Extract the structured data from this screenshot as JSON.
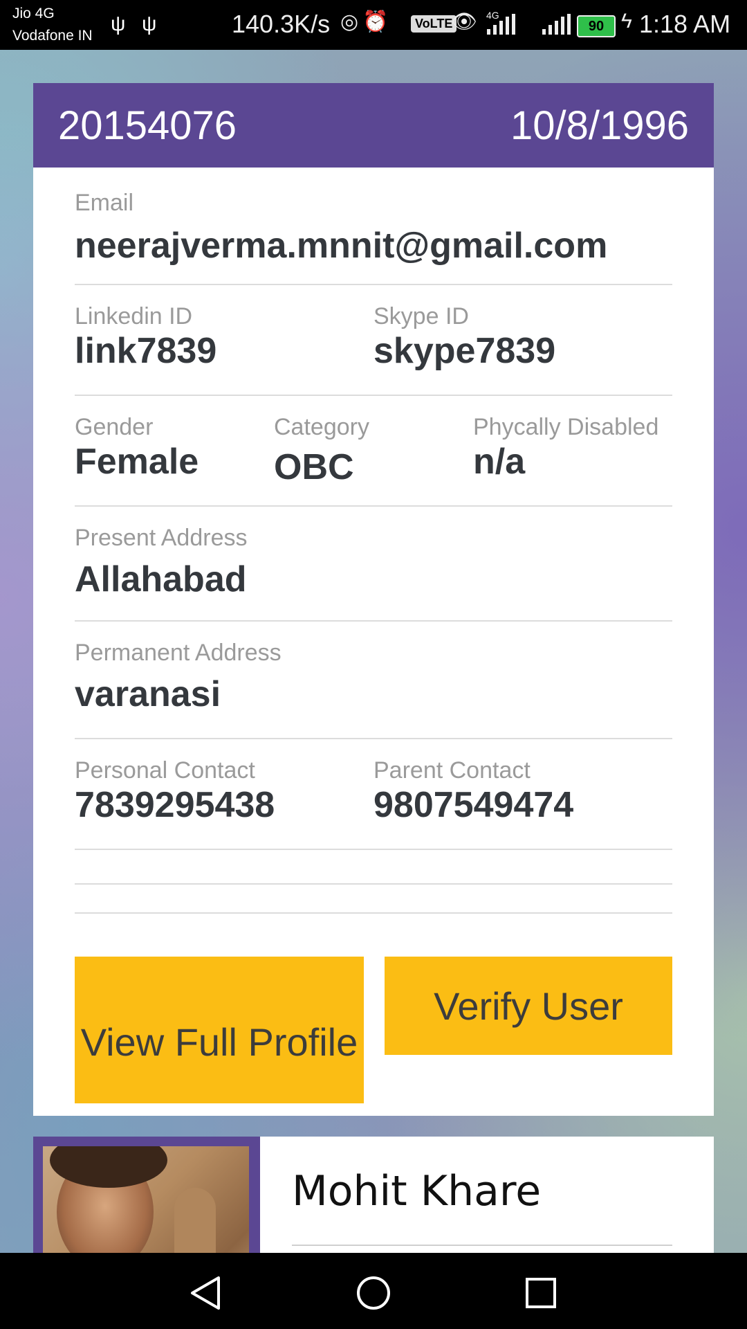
{
  "status_bar": {
    "carrier_1": "Jio 4G",
    "carrier_2": "Vodafone IN",
    "net_speed": "140.3K/s",
    "volte": "VoLTE",
    "network_type": "4G",
    "battery": "90",
    "time": "1:18 AM",
    "icons": [
      "usb-icon",
      "usb-icon",
      "hotspot-icon",
      "alarm-icon",
      "volte-icon",
      "eye-icon",
      "signal-icon",
      "signal-icon",
      "battery-icon",
      "charging-icon"
    ]
  },
  "card": {
    "header": {
      "id": "20154076",
      "dob": "10/8/1996",
      "color": "#5b4793"
    },
    "email": {
      "label": "Email",
      "value": "neerajverma.mnnit@gmail.com"
    },
    "linkedin": {
      "label": "Linkedin ID",
      "value": "link7839"
    },
    "skype": {
      "label": "Skype ID",
      "value": "skype7839"
    },
    "gender": {
      "label": "Gender",
      "value": "Female"
    },
    "category": {
      "label": "Category",
      "value": "OBC"
    },
    "disabled": {
      "label": "Phycally Disabled",
      "value": "n/a"
    },
    "present_address": {
      "label": "Present Address",
      "value": "Allahabad"
    },
    "permanent_address": {
      "label": "Permanent Address",
      "value": "varanasi"
    },
    "personal_contact": {
      "label": "Personal Contact",
      "value": "7839295438"
    },
    "parent_contact": {
      "label": "Parent Contact",
      "value": "9807549474"
    },
    "buttons": {
      "view_full_profile": "View Full Profile",
      "verify_user": "Verify User",
      "color": "#fbbd14"
    }
  },
  "next_card": {
    "name": "Mohit Khare"
  }
}
